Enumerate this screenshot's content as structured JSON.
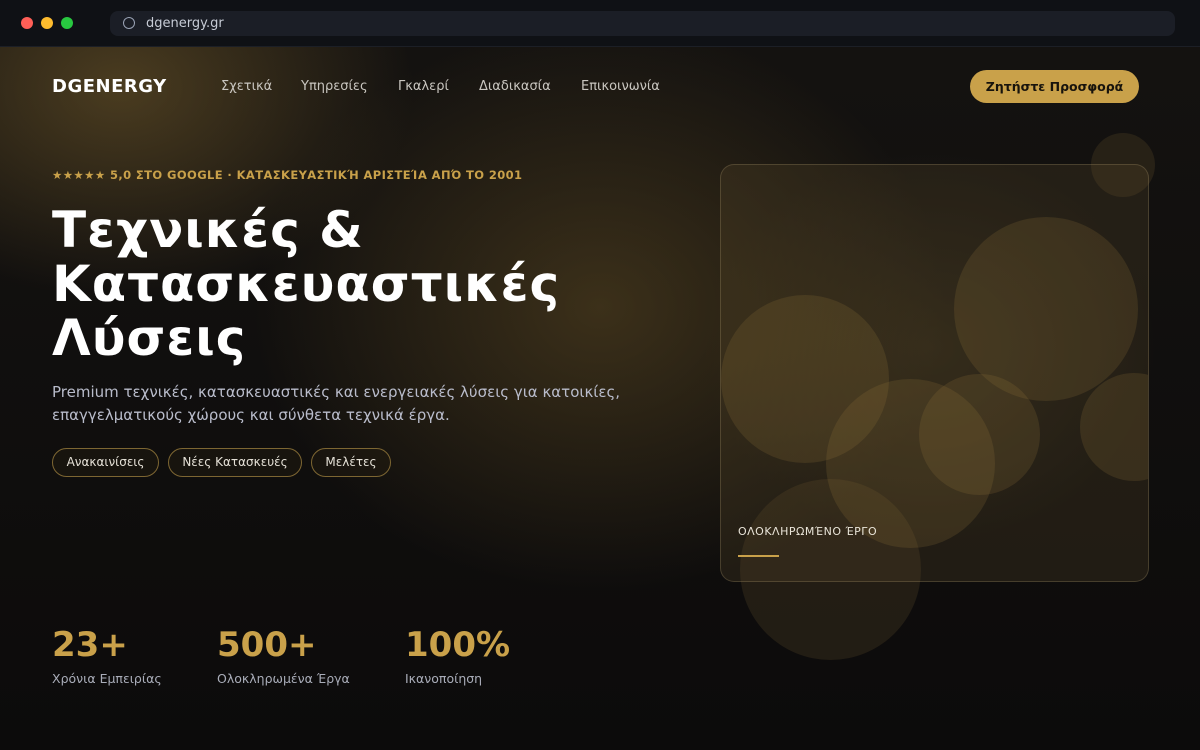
{
  "browser": {
    "url": "dgenergy.gr"
  },
  "header": {
    "logo": "DGENERGY",
    "nav": [
      "Σχετικά",
      "Υπηρεσίες",
      "Γκαλερί",
      "Διαδικασία",
      "Επικοινωνία"
    ],
    "cta_label": "Ζητήστε Προσφορά"
  },
  "hero": {
    "eyebrow": "★★★★★ 5,0 ΣΤΟ GOOGLE · ΚΑΤΑΣΚΕΥΑΣΤΙΚΉ ΑΡΙΣΤΕΊΑ ΑΠΌ ΤΟ 2001",
    "headline": [
      "Τεχνικές &",
      "Κατασκευαστικές",
      "Λύσεις"
    ],
    "lead": "Premium τεχνικές, κατασκευαστικές και ενεργειακές λύσεις για κατοικίες, επαγγελματικούς χώρους και σύνθετα τεχνικά έργα.",
    "tags": [
      "Ανακαινίσεις",
      "Νέες Κατασκευές",
      "Μελέτες"
    ]
  },
  "showcase": {
    "label": "ΟΛΟΚΛΗΡΩΜΈΝΟ ΈΡΓΟ"
  },
  "stats": [
    {
      "value": "23+",
      "label": "Χρόνια Εμπειρίας"
    },
    {
      "value": "500+",
      "label": "Ολοκληρωμένα Έργα"
    },
    {
      "value": "100%",
      "label": "Ικανοποίηση"
    }
  ],
  "colors": {
    "accent": "#c9a14a",
    "background": "#0b0b0d"
  }
}
